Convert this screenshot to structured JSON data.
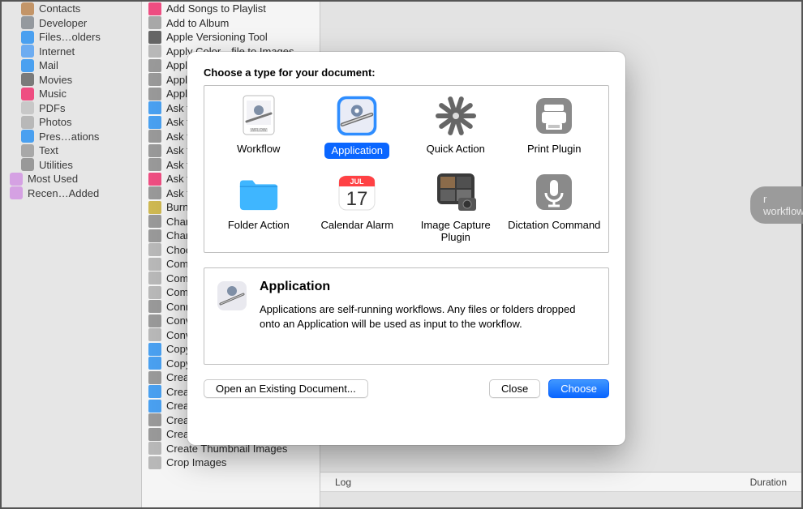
{
  "sidebar1": {
    "items": [
      {
        "label": "Contacts",
        "color": "#cd9b6a"
      },
      {
        "label": "Developer",
        "color": "#9aa0a6"
      },
      {
        "label": "Files…olders",
        "color": "#4aa8ff"
      },
      {
        "label": "Internet",
        "color": "#6fb4ff"
      },
      {
        "label": "Mail",
        "color": "#4aa8ff"
      },
      {
        "label": "Movies",
        "color": "#808080"
      },
      {
        "label": "Music",
        "color": "#ff4f87"
      },
      {
        "label": "PDFs",
        "color": "#d0d0d0"
      },
      {
        "label": "Photos",
        "color": "#c0c0c0"
      },
      {
        "label": "Pres…ations",
        "color": "#4aa8ff"
      },
      {
        "label": "Text",
        "color": "#b0b0b0"
      },
      {
        "label": "Utilities",
        "color": "#a0a0a0"
      }
    ],
    "roots": [
      {
        "label": "Most Used",
        "color": "#e0a7f0"
      },
      {
        "label": "Recen…Added",
        "color": "#e0a7f0"
      }
    ]
  },
  "sidebar2": {
    "items": [
      {
        "label": "Add Songs to Playlist",
        "color": "#ff4f87"
      },
      {
        "label": "Add to Album",
        "color": "#b0b0b0"
      },
      {
        "label": "Apple Versioning Tool",
        "color": "#6a6a6a"
      },
      {
        "label": "Apply Color…file to Images",
        "color": "#c0c0c0"
      },
      {
        "label": "Apply",
        "color": "#a0a0a0"
      },
      {
        "label": "Apply",
        "color": "#a0a0a0"
      },
      {
        "label": "Apply",
        "color": "#a0a0a0"
      },
      {
        "label": "Ask f",
        "color": "#4aa8ff"
      },
      {
        "label": "Ask f",
        "color": "#4aa8ff"
      },
      {
        "label": "Ask f",
        "color": "#a0a0a0"
      },
      {
        "label": "Ask f",
        "color": "#a0a0a0"
      },
      {
        "label": "Ask f",
        "color": "#a0a0a0"
      },
      {
        "label": "Ask for",
        "color": "#ff4f87"
      },
      {
        "label": "Ask f",
        "color": "#a0a0a0"
      },
      {
        "label": "Burn",
        "color": "#d9c050"
      },
      {
        "label": "Chan",
        "color": "#a0a0a0"
      },
      {
        "label": "Chan",
        "color": "#a0a0a0"
      },
      {
        "label": "Choo",
        "color": "#c0c0c0"
      },
      {
        "label": "Comb",
        "color": "#c0c0c0"
      },
      {
        "label": "Comb",
        "color": "#c0c0c0"
      },
      {
        "label": "Comp",
        "color": "#c0c0c0"
      },
      {
        "label": "Conn",
        "color": "#a0a0a0"
      },
      {
        "label": "Conv",
        "color": "#a0a0a0"
      },
      {
        "label": "Conv",
        "color": "#c0c0c0"
      },
      {
        "label": "Copy",
        "color": "#4aa8ff"
      },
      {
        "label": "Copy",
        "color": "#4aa8ff"
      },
      {
        "label": "Creat",
        "color": "#a0a0a0"
      },
      {
        "label": "Creat",
        "color": "#4aa8ff"
      },
      {
        "label": "Creat",
        "color": "#4aa8ff"
      },
      {
        "label": "Creat",
        "color": "#a0a0a0"
      },
      {
        "label": "Create Package",
        "color": "#a0a0a0"
      },
      {
        "label": "Create Thumbnail Images",
        "color": "#c0c0c0"
      },
      {
        "label": "Crop Images",
        "color": "#c0c0c0"
      }
    ]
  },
  "sheet": {
    "title": "Choose a type for your document:",
    "types": [
      {
        "label": "Workflow",
        "id": "workflow",
        "selected": false
      },
      {
        "label": "Application",
        "id": "application",
        "selected": true
      },
      {
        "label": "Quick Action",
        "id": "quick-action",
        "selected": false
      },
      {
        "label": "Print Plugin",
        "id": "print-plugin",
        "selected": false
      },
      {
        "label": "Folder Action",
        "id": "folder-action",
        "selected": false
      },
      {
        "label": "Calendar Alarm",
        "id": "calendar-alarm",
        "selected": false
      },
      {
        "label": "Image Capture Plugin",
        "id": "image-capture",
        "selected": false
      },
      {
        "label": "Dictation Command",
        "id": "dictation",
        "selected": false
      }
    ],
    "desc_title": "Application",
    "desc_text": "Applications are self-running workflows. Any files or folders dropped onto an Application will be used as input to the workflow.",
    "open_existing": "Open an Existing Document...",
    "close": "Close",
    "choose": "Choose"
  },
  "main": {
    "pill": "r workflow.",
    "log": "Log",
    "duration": "Duration"
  },
  "calendar": {
    "month": "JUL",
    "day": "17"
  }
}
